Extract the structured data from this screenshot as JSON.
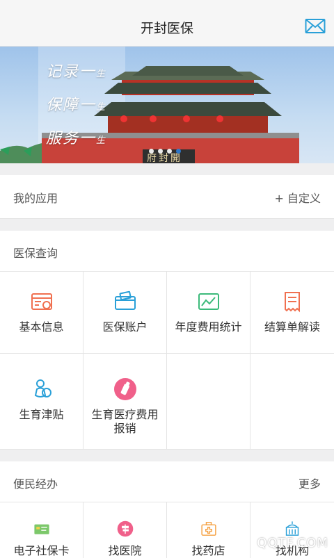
{
  "nav": {
    "title": "开封医保"
  },
  "banner": {
    "lines": [
      {
        "main": "记录一",
        "tail": "生"
      },
      {
        "main": "保障一",
        "tail": "生"
      },
      {
        "main": "服务一",
        "tail": "生"
      }
    ],
    "gate_plaque": "府封開"
  },
  "apps": {
    "label": "我的应用",
    "action": "+ 自定义"
  },
  "query": {
    "label": "医保查询",
    "items": [
      {
        "label": "基本信息",
        "icon": "id-card-icon"
      },
      {
        "label": "医保账户",
        "icon": "wallet-icon"
      },
      {
        "label": "年度费用统计",
        "icon": "chart-icon"
      },
      {
        "label": "结算单解读",
        "icon": "receipt-icon"
      },
      {
        "label": "生育津贴",
        "icon": "baby-icon"
      },
      {
        "label": "生育医疗费用报销",
        "icon": "bottle-icon"
      }
    ]
  },
  "service": {
    "label": "便民经办",
    "action": "更多",
    "items": [
      {
        "label": "电子社保卡",
        "icon": "card-icon"
      },
      {
        "label": "找医院",
        "icon": "signpost-icon"
      },
      {
        "label": "找药店",
        "icon": "medkit-icon"
      },
      {
        "label": "找机构",
        "icon": "building-icon"
      }
    ]
  },
  "watermark": "QQTF.COM"
}
